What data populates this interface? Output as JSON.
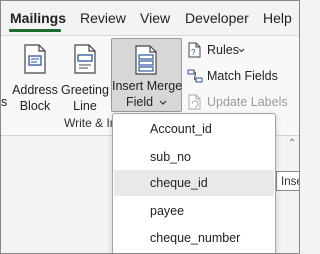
{
  "tabs": [
    {
      "label": "Mailings",
      "active": true
    },
    {
      "label": "Review",
      "active": false
    },
    {
      "label": "View",
      "active": false
    },
    {
      "label": "Developer",
      "active": false
    },
    {
      "label": "Help",
      "active": false
    }
  ],
  "ribbon": {
    "cut_label": "s",
    "address_block": [
      "Address",
      "Block"
    ],
    "greeting_line": [
      "Greeting",
      "Line"
    ],
    "insert_merge_field": [
      "Insert Merge",
      "Field"
    ],
    "rules_label": "Rules",
    "match_fields_label": "Match Fields",
    "update_labels_label": "Update Labels",
    "group_label": "Write & In"
  },
  "dropdown": {
    "items": [
      "Account_id",
      "sub_no",
      "cheque_id",
      "payee",
      "cheque_number"
    ],
    "hover_index": 2
  },
  "tooltip": {
    "text": "Inse"
  },
  "colors": {
    "accent": "#1e6c2f",
    "icon_blue": "#2b579a",
    "disabled": "#9a9a9a"
  }
}
